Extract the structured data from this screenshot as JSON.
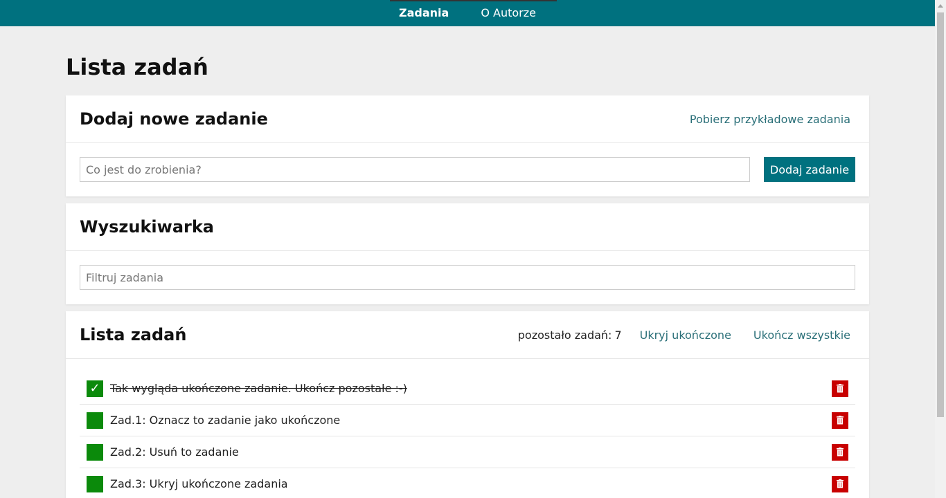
{
  "nav": {
    "items": [
      {
        "label": "Zadania",
        "active": true
      },
      {
        "label": "O Autorze",
        "active": false
      }
    ]
  },
  "page_title": "Lista zadań",
  "add_card": {
    "title": "Dodaj nowe zadanie",
    "sample_link": "Pobierz przykładowe zadania",
    "input_placeholder": "Co jest do zrobienia?",
    "input_value": "",
    "button_label": "Dodaj zadanie"
  },
  "search_card": {
    "title": "Wyszukiwarka",
    "input_placeholder": "Filtruj zadania",
    "input_value": ""
  },
  "list_card": {
    "title": "Lista zadań",
    "remaining_label": "pozostało zadań:",
    "remaining_count": "7",
    "hide_done_link": "Ukryj ukończone",
    "complete_all_link": "Ukończ wszystkie",
    "tasks": [
      {
        "text": "Tak wygląda ukończone zadanie. Ukończ pozostałe :-)",
        "done": true
      },
      {
        "text": "Zad.1: Oznacz to zadanie jako ukończone",
        "done": false
      },
      {
        "text": "Zad.2: Usuń to zadanie",
        "done": false
      },
      {
        "text": "Zad.3: Ukryj ukończone zadania",
        "done": false
      }
    ]
  },
  "colors": {
    "accent": "#00717f",
    "check_green": "#0b8a0b",
    "delete_red": "#c80000",
    "background": "#eeeeee"
  },
  "icons": {
    "check": "check-icon",
    "delete": "trash-icon"
  }
}
